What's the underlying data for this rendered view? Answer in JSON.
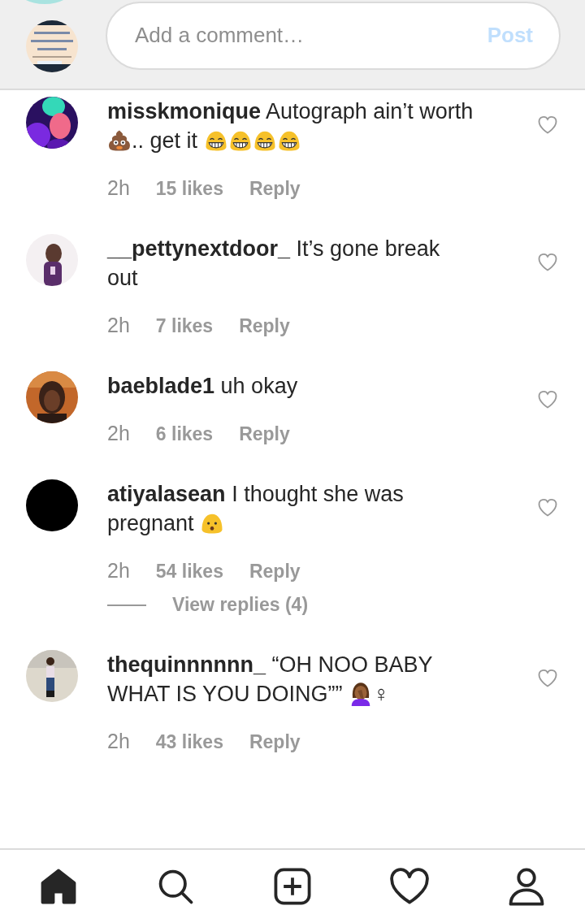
{
  "composer": {
    "placeholder": "Add a comment…",
    "post_label": "Post",
    "post_enabled": false
  },
  "comments": [
    {
      "user": "misskmonique",
      "parts": [
        {
          "kind": "text",
          "text": "Autograph ain’t worth "
        },
        {
          "kind": "poop-emoji"
        },
        {
          "kind": "text",
          "text": ".. get it "
        },
        {
          "kind": "laugh-emoji"
        },
        {
          "kind": "laugh-emoji"
        },
        {
          "kind": "laugh-emoji"
        },
        {
          "kind": "laugh-emoji"
        }
      ],
      "time": "2h",
      "likes": "15 likes",
      "reply": "Reply",
      "liked": false
    },
    {
      "user": "__pettynextdoor_",
      "parts": [
        {
          "kind": "text",
          "text": "It’s gone break out"
        }
      ],
      "time": "2h",
      "likes": "7 likes",
      "reply": "Reply",
      "liked": false
    },
    {
      "user": "baeblade1",
      "parts": [
        {
          "kind": "text",
          "text": "uh okay"
        }
      ],
      "time": "2h",
      "likes": "6 likes",
      "reply": "Reply",
      "liked": false
    },
    {
      "user": "atiyalasean",
      "parts": [
        {
          "kind": "text",
          "text": "I thought she was pregnant "
        },
        {
          "kind": "surprised-emoji"
        }
      ],
      "time": "2h",
      "likes": "54 likes",
      "reply": "Reply",
      "liked": false,
      "view_replies": "View replies (4)"
    },
    {
      "user": "thequinnnnnn_",
      "parts": [
        {
          "kind": "text",
          "text": "“OH NOO BABY WHAT IS YOU DOING”” "
        },
        {
          "kind": "facepalm-emoji"
        },
        {
          "kind": "text",
          "text": "♀"
        }
      ],
      "time": "2h",
      "likes": "43 likes",
      "reply": "Reply",
      "liked": false
    }
  ],
  "nav": [
    {
      "kind": "home",
      "selected": true
    },
    {
      "kind": "search",
      "selected": false
    },
    {
      "kind": "add",
      "selected": false
    },
    {
      "kind": "heart",
      "selected": false
    },
    {
      "kind": "profile",
      "selected": false
    }
  ]
}
